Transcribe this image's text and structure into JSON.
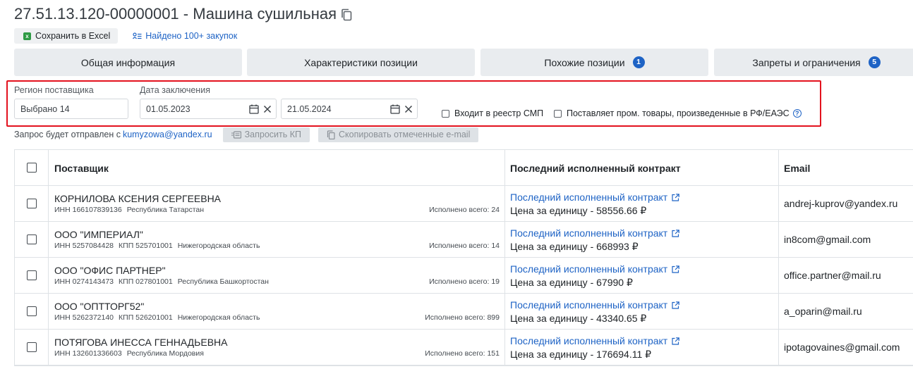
{
  "header": {
    "title": "27.51.13.120-00000001 - Машина сушильная",
    "excel_label": "Сохранить в Excel",
    "found_label": "Найдено 100+ закупок"
  },
  "tabs": [
    {
      "label": "Общая информация",
      "badge": null
    },
    {
      "label": "Характеристики позиции",
      "badge": null
    },
    {
      "label": "Похожие позиции",
      "badge": "1"
    },
    {
      "label": "Запреты и ограничения",
      "badge": "5"
    }
  ],
  "filters": {
    "region_label": "Регион поставщика",
    "region_value": "Выбрано 14",
    "date_label": "Дата заключения",
    "date_from": "01.05.2023",
    "date_to": "21.05.2024",
    "smp_label": "Входит в реестр СМП",
    "rf_label": "Поставляет пром. товары, произведенные в РФ/ЕАЭС"
  },
  "request": {
    "text": "Запрос будет отправлен с",
    "email": "kumyzowa@yandex.ru",
    "request_kp_label": "Запросить КП",
    "copy_emails_label": "Скопировать отмеченные e-mail"
  },
  "table": {
    "headers": {
      "supplier": "Поставщик",
      "contract": "Последний исполненный контракт",
      "email": "Email"
    },
    "rows": [
      {
        "name": "КОРНИЛОВА КСЕНИЯ СЕРГЕЕВНА",
        "inn": "ИНН 166107839136",
        "kpp": "",
        "region": "Республика Татарстан",
        "done": "Исполнено всего: 24",
        "contract_link": "Последний исполненный контракт",
        "price": "Цена за единицу - 58556.66 ₽",
        "email": "andrej-kuprov@yandex.ru"
      },
      {
        "name": "ООО \"ИМПЕРИАЛ\"",
        "inn": "ИНН 5257084428",
        "kpp": "КПП 525701001",
        "region": "Нижегородская область",
        "done": "Исполнено всего: 14",
        "contract_link": "Последний исполненный контракт",
        "price": "Цена за единицу - 668993 ₽",
        "email": "in8com@gmail.com"
      },
      {
        "name": "ООО \"ОФИС ПАРТНЕР\"",
        "inn": "ИНН 0274143473",
        "kpp": "КПП 027801001",
        "region": "Республика Башкортостан",
        "done": "Исполнено всего: 19",
        "contract_link": "Последний исполненный контракт",
        "price": "Цена за единицу - 67990 ₽",
        "email": "office.partner@mail.ru"
      },
      {
        "name": "ООО \"ОПТТОРГ52\"",
        "inn": "ИНН 5262372140",
        "kpp": "КПП 526201001",
        "region": "Нижегородская область",
        "done": "Исполнено всего: 899",
        "contract_link": "Последний исполненный контракт",
        "price": "Цена за единицу - 43340.65 ₽",
        "email": "a_oparin@mail.ru"
      },
      {
        "name": "ПОТЯГОВА ИНЕССА ГЕННАДЬЕВНА",
        "inn": "ИНН 132601336603",
        "kpp": "",
        "region": "Республика Мордовия",
        "done": "Исполнено всего: 151",
        "contract_link": "Последний исполненный контракт",
        "price": "Цена за единицу - 176694.11 ₽",
        "email": "ipotagovaines@gmail.com"
      }
    ]
  }
}
